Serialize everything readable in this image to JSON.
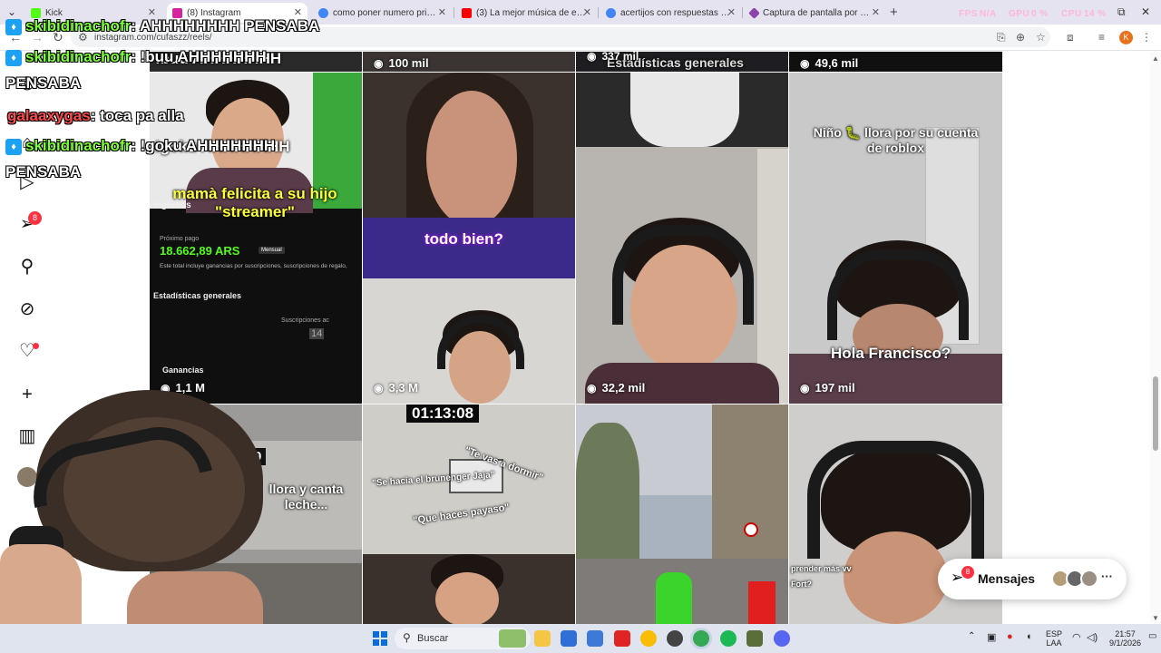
{
  "browser": {
    "tabs": [
      {
        "title": "Kick",
        "favicon_color": "#53fc18",
        "active": false
      },
      {
        "title": "(8) Instagram",
        "favicon_color": "#d6249f",
        "active": true
      },
      {
        "title": "como poner numero privado",
        "favicon_color": "#4285f4",
        "active": false
      },
      {
        "title": "(3) La mejor música de elevador",
        "favicon_color": "#ff0000",
        "active": false
      },
      {
        "title": "acertijos con respuestas - Busca",
        "favicon_color": "#4285f4",
        "active": false
      },
      {
        "title": "Captura de pantalla por Lightsh",
        "favicon_color": "#8e44ad",
        "active": false
      }
    ],
    "tab_close": "✕",
    "new_tab": "+",
    "url": "instagram.com/cufaszz/reels/",
    "profile_initial": "K"
  },
  "overlay_perf": {
    "fps_label": "FPS",
    "fps_value": "N/A",
    "gpu_label": "GPU",
    "gpu_value": "0 %",
    "cpu_label": "CPU",
    "cpu_value": "14 %"
  },
  "sidebar": {
    "notifications_count": "8"
  },
  "reels": [
    {
      "caption_top": "!goku AHHHHHHH",
      "caption_main": "mamà felicita a su hijo \"streamer\"",
      "dash_label": "Ingresos",
      "next_pay_label": "Próximo pago",
      "amount": "18.662,89 ARS",
      "amount_tag": "Mensual",
      "dash_note": "Este total incluye ganancias por suscripciones, suscripciones de regalo,",
      "stats_label": "Estadísticas generales",
      "subs_label": "Suscripciones ac",
      "subs_value": "14",
      "earnings_label": "Ganancias",
      "views": "1,1 M"
    },
    {
      "caption_main": "todo bien?",
      "views": "3,3 M"
    },
    {
      "views": "32,2 mil"
    },
    {
      "caption_main": "Niño 🐛 llora por su cuenta de roblox",
      "caption_bottom": "Hola Francisco?",
      "views": "197 mil"
    },
    {
      "timer": "41:40",
      "caption_main": "llora y canta leche...",
      "views": ""
    },
    {
      "timer": "01:13:08",
      "quote1": "\"Se hacia el brunenger Jaja\"",
      "quote2": "\"Te vas a dormir\"",
      "quote3": "\"Que haces payaso\""
    },
    {
      "street_scene": true
    },
    {
      "caption_bottom": "prender más vv",
      "caption_bottom2": "Fort?"
    }
  ],
  "top_row_views": [
    "100 mil",
    "337 mil",
    "49,6 mil"
  ],
  "top_row_text": [
    "!buu AHHHHHHH",
    "Estadísticas generales"
  ],
  "messages": {
    "label": "Mensajes",
    "badge": "8",
    "more": "···"
  },
  "chat": [
    {
      "user": "skibidinachofr",
      "msg": ": AHHHHHHHH PENSABA",
      "color": "#7dff3a",
      "badge": true
    },
    {
      "user": "skibidinachofr",
      "msg": ": !buu AHHHHHHH",
      "color": "#7dff3a",
      "badge": true
    },
    {
      "user": "",
      "msg": "PENSABA",
      "color": "#ffffff",
      "badge": false
    },
    {
      "user": "galaaxygas",
      "msg": ": toca pa alla",
      "color": "#ff4b4b",
      "badge": false
    },
    {
      "user": "skibidinachofr",
      "msg": ": !goku AHHHHHHH",
      "color": "#7dff3a",
      "badge": true
    },
    {
      "user": "",
      "msg": "PENSABA",
      "color": "#ffffff",
      "badge": false
    }
  ],
  "taskbar": {
    "search_label": "Buscar",
    "lang": "ESP",
    "lang2": "LAA",
    "time": "21:57",
    "date": "9/1/2026"
  }
}
